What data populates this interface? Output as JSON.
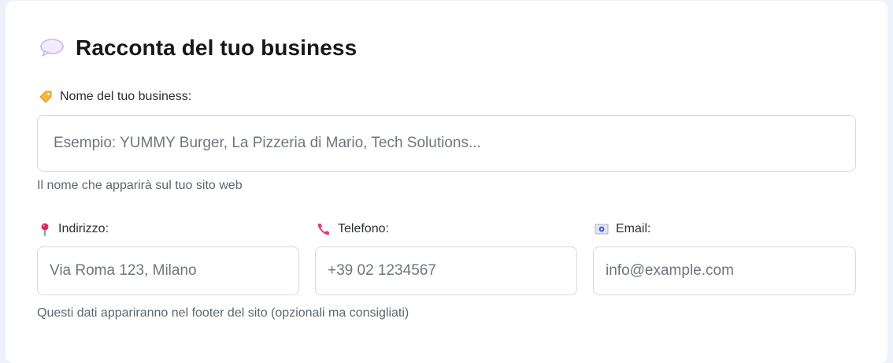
{
  "section": {
    "title": "Racconta del tuo business"
  },
  "business_name": {
    "label": "Nome del tuo business:",
    "placeholder": "Esempio: YUMMY Burger, La Pizzeria di Mario, Tech Solutions...",
    "help": "Il nome che apparirà sul tuo sito web",
    "icon": "tag-icon"
  },
  "address": {
    "label": "Indirizzo:",
    "placeholder": "Via Roma 123, Milano",
    "icon": "pin-icon"
  },
  "phone": {
    "label": "Telefono:",
    "placeholder": "+39 02 1234567",
    "icon": "phone-icon"
  },
  "email": {
    "label": "Email:",
    "placeholder": "info@example.com",
    "icon": "email-icon"
  },
  "contacts_help": "Questi dati appariranno nel footer del sito (opzionali ma consigliati)",
  "colors": {
    "background": "#eef0fb",
    "card": "#ffffff",
    "border": "#d5d8de",
    "title": "#16181d",
    "help": "#5f6670"
  }
}
